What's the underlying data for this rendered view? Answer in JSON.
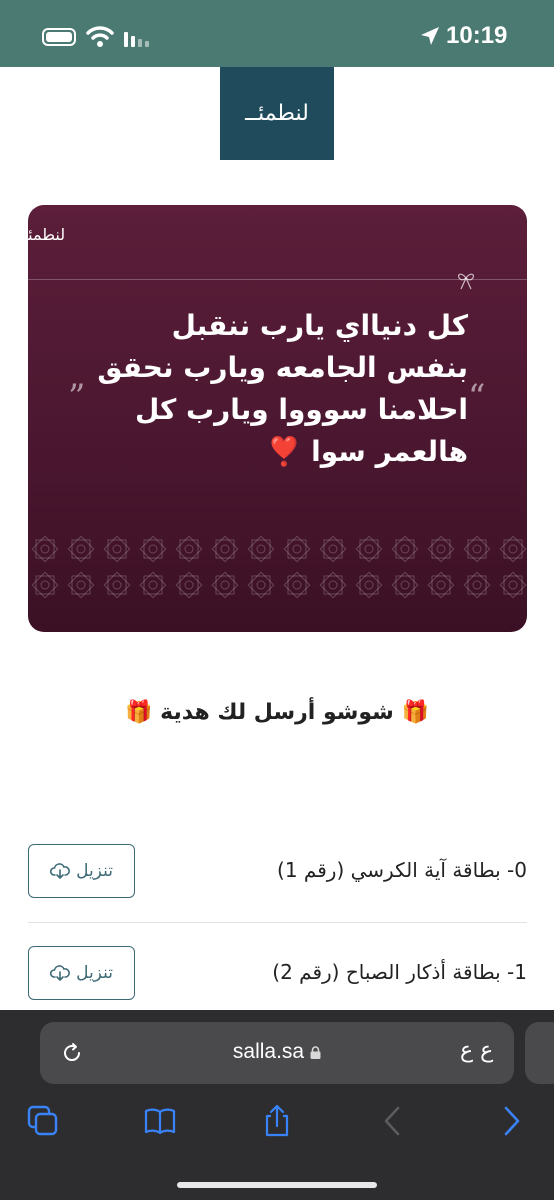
{
  "status_bar": {
    "time": "10:19"
  },
  "header": {
    "logo_text": "لنطمئــ"
  },
  "card": {
    "brand": "لنطمئن",
    "message": "كل دنيااي يارب ننقبل بنفس الجامعه ويارب نحقق احلامنا سوووا ويارب كل هالعمر سوا ❣️",
    "quote_open": "”",
    "quote_close": "“"
  },
  "gift_title": "🎁 شوشو أرسل لك هدية 🎁",
  "downloads": [
    {
      "label": "0- بطاقة آية الكرسي (رقم 1)",
      "button": "تنزيل"
    },
    {
      "label": "1- بطاقة أذكار الصباح (رقم 2)",
      "button": "تنزيل"
    }
  ],
  "browser": {
    "url": "salla.sa",
    "text_size_label": "ع ع"
  },
  "colors": {
    "status_bar": "#4b7a72",
    "logo_bg": "#1f4b5c",
    "card_bg": "#4b1730",
    "accent": "#3e6a76",
    "toolbar_bg": "#2d2d2f",
    "link_blue": "#3a82f7"
  }
}
